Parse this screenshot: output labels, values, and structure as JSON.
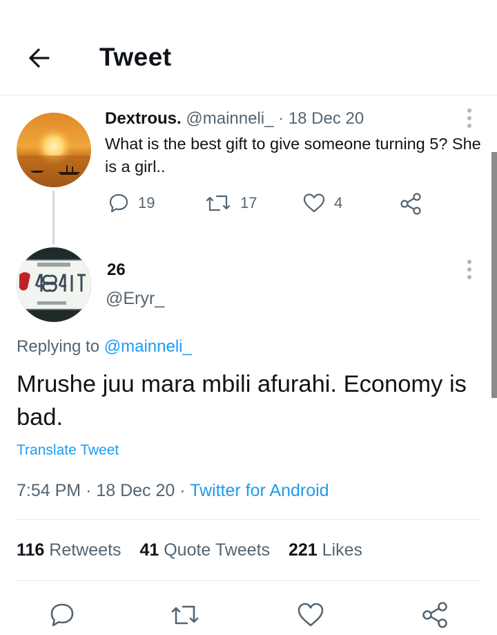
{
  "header": {
    "title": "Tweet",
    "back_icon": "arrow-left-icon"
  },
  "parent_tweet": {
    "display_name": "Dextrous.",
    "handle": "@mainneli_",
    "separator": "·",
    "date": "18 Dec 20",
    "text": "What is the best gift to give someone turning 5? She is a girl..",
    "replies": "19",
    "retweets": "17",
    "likes": "4"
  },
  "main_tweet": {
    "display_name": "26",
    "handle": "@Eryr_",
    "replying_prefix": "Replying to",
    "replying_to": "@mainneli_",
    "text": "Mrushe juu mara mbili afurahi. Economy is bad.",
    "translate_label": "Translate Tweet",
    "time": "7:54 PM",
    "separator": "·",
    "date": "18 Dec 20",
    "source": "Twitter for Android"
  },
  "stats": {
    "retweets_count": "116",
    "retweets_label": "Retweets",
    "quotes_count": "41",
    "quotes_label": "Quote Tweets",
    "likes_count": "221",
    "likes_label": "Likes"
  },
  "colors": {
    "link": "#1d9bf0",
    "muted": "#536471",
    "text": "#0f1419",
    "divider": "#e1e8ed"
  }
}
